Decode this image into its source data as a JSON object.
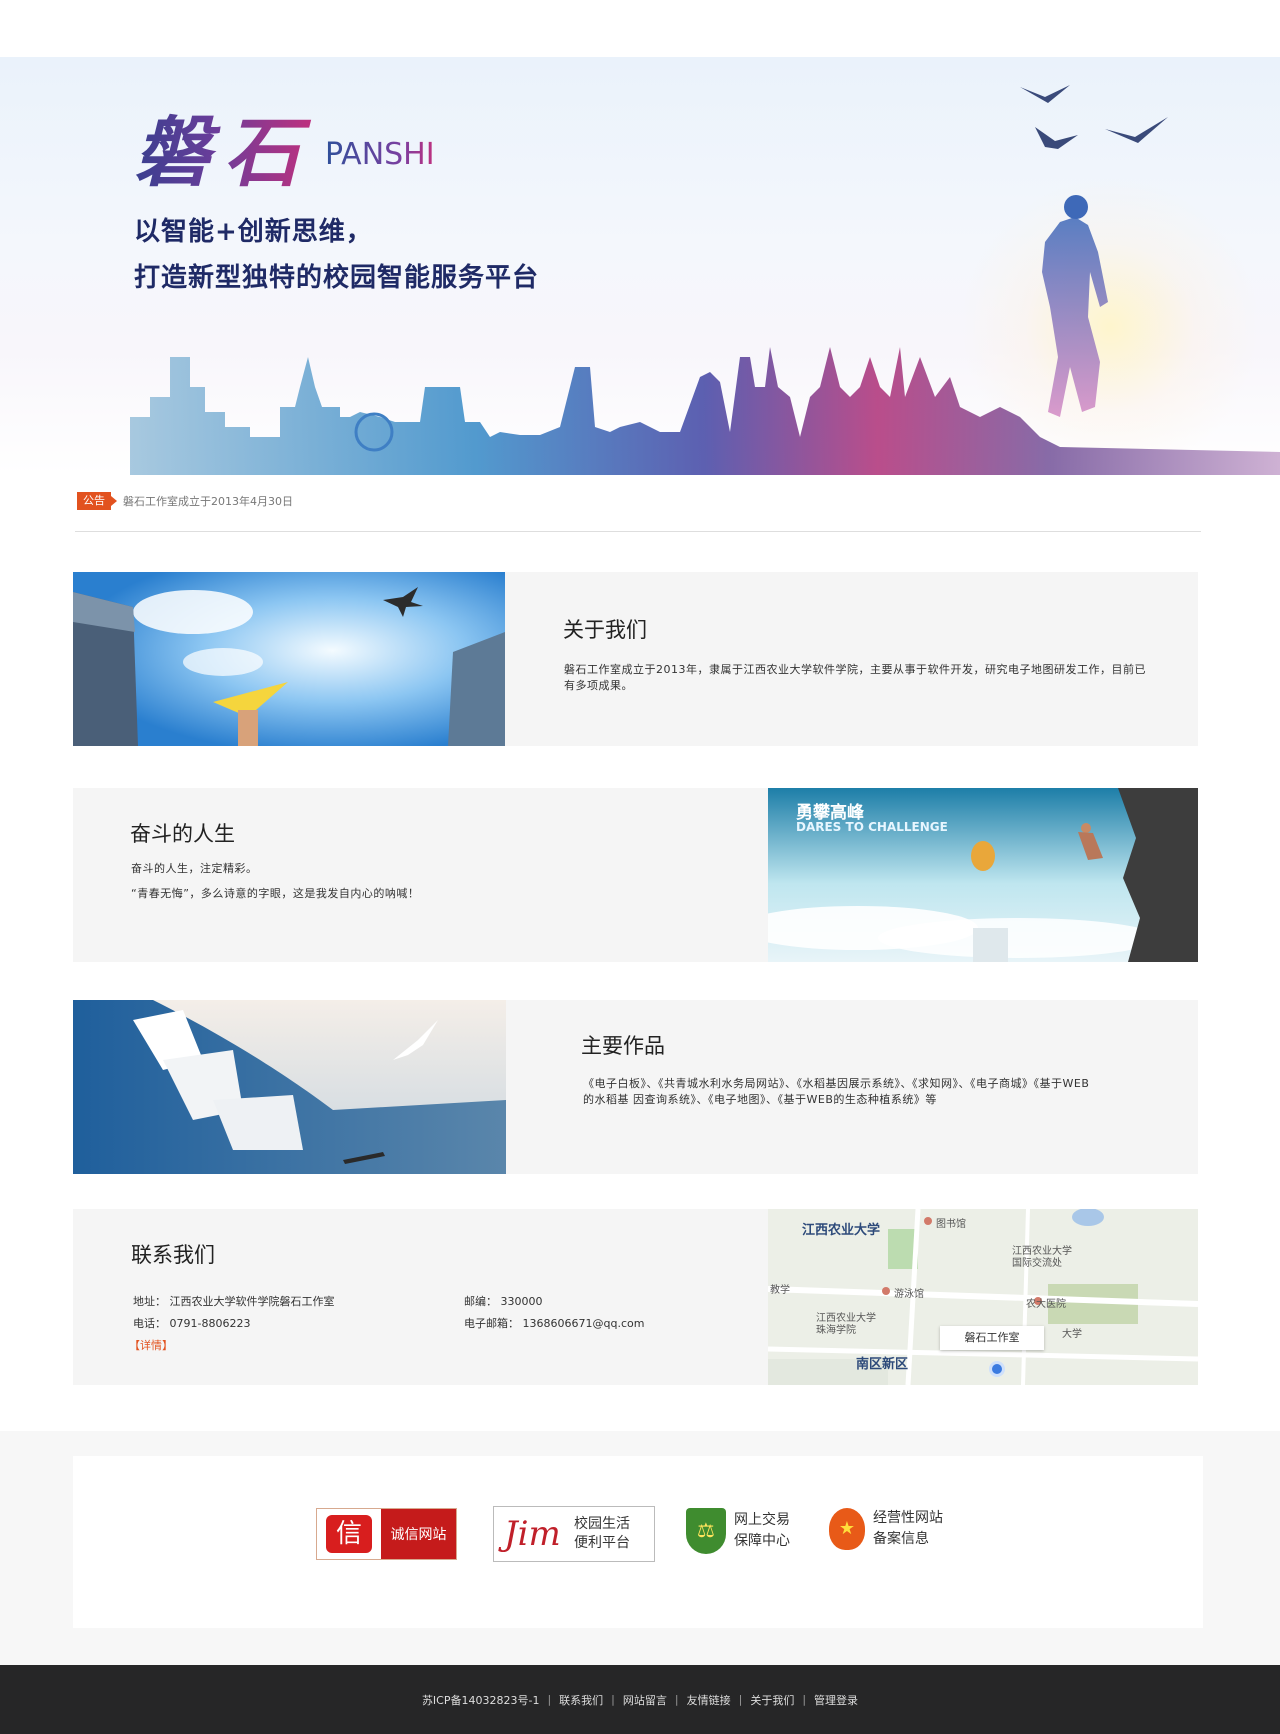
{
  "banner": {
    "logo_cn": "磐石",
    "logo_en": "PANSHI",
    "slogan_line1": "以智能+创新思维，",
    "slogan_line2": "打造新型独特的校园智能服务平台"
  },
  "notice": {
    "badge": "公告",
    "text": "磐石工作室成立于2013年4月30日"
  },
  "about": {
    "title": "关于我们",
    "body": "磐石工作室成立于2013年，隶属于江西农业大学软件学院，主要从事于软件开发，研究电子地图研发工作，目前已有多项成果。"
  },
  "life": {
    "title": "奋斗的人生",
    "line1": "奋斗的人生，注定精彩。",
    "line2": "“青春无悔”，多么诗意的字眼，这是我发自内心的呐喊！",
    "image_title": "勇攀高峰",
    "image_subtitle": "DARES TO CHALLENGE"
  },
  "works": {
    "title": "主要作品",
    "body_line1": "《电子白板》、《共青城水利水务局网站》、《水稻基因展示系统》、《求知网》、《电子商城》《基于WEB",
    "body_line2": "的水稻基   因查询系统》、《电子地图》、《基于WEB的生态种植系统》等"
  },
  "contact": {
    "title": "联系我们",
    "address_label": "地址：",
    "address": "江西农业大学软件学院磐石工作室",
    "phone_label": "电话：",
    "phone": "0791-8806223",
    "postcode_label": "邮编：",
    "postcode": "330000",
    "email_label": "电子邮箱：",
    "email": "1368606671@qq.com",
    "detail_link": "【详情】",
    "map": {
      "campus": "江西农业大学",
      "library": "图书馆",
      "gym": "游泳馆",
      "intl": "江西农业大学",
      "intl2": "国际交流处",
      "south": "南区新区",
      "school": "江西农业大学",
      "school2": "珠海学院",
      "hospital": "农大医院",
      "marker": "磐石工作室",
      "xue": "大学",
      "jiao": "教学"
    }
  },
  "trust": {
    "chengxin_seal": "信",
    "chengxin_label": "诚信网站",
    "jim_logo": "Jim",
    "jim_line1": "校园生活",
    "jim_line2": "便利平台",
    "wsjy_line1": "网上交易",
    "wsjy_line2": "保障中心",
    "jyx_line1": "经营性网站",
    "jyx_line2": "备案信息"
  },
  "footer": {
    "icp": "苏ICP备14032823号-1",
    "links": [
      "联系我们",
      "网站留言",
      "友情链接",
      "关于我们",
      "管理登录"
    ]
  }
}
